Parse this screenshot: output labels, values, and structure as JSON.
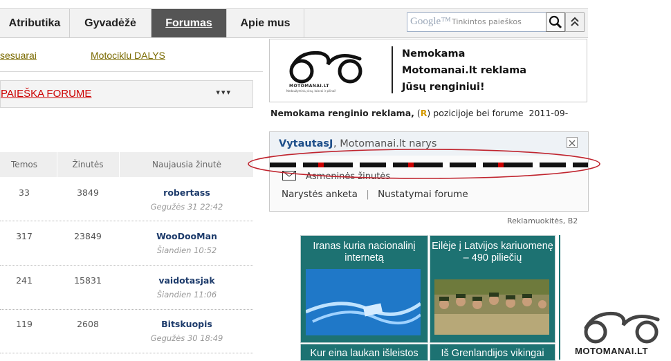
{
  "nav": {
    "items": [
      {
        "label": "Atributika"
      },
      {
        "label": "Gyvadėžė"
      },
      {
        "label": "Forumas",
        "active": true
      },
      {
        "label": "Apie mus"
      }
    ]
  },
  "search": {
    "brand": "Google™",
    "placeholder": "Tinkintos paieškos"
  },
  "sublinks": [
    "sesuarai",
    "Motociklu DALYS"
  ],
  "forum_search": {
    "label": "PAIEŠKA FORUME",
    "arrows": "▾▾▾"
  },
  "table": {
    "headers": [
      "Temos",
      "Žinutės",
      "Naujausia žinutė"
    ],
    "rows": [
      {
        "topics": "33",
        "posts": "3849",
        "author": "robertass",
        "date": "Gegužės 31 22:42"
      },
      {
        "topics": "317",
        "posts": "23849",
        "author": "WooDooMan",
        "date": "Šiandien 10:52"
      },
      {
        "topics": "241",
        "posts": "15831",
        "author": "vaidotasjak",
        "date": "Šiandien 11:06"
      },
      {
        "topics": "119",
        "posts": "2608",
        "author": "Bitskuopis",
        "date": "Gegužės 30 18:49"
      }
    ]
  },
  "ad": {
    "logo_text": "MOTOMANAI.LT",
    "logo_sub": "Nedaužyminių visų, laisvai ir pilinai!",
    "line1": "Nemokama",
    "line2": "Motomanai.lt reklama",
    "line3": "Jūsų renginiui!"
  },
  "promo": {
    "text": "Nemokama renginio reklama,",
    "r_open": "(",
    "r": "R",
    "r_close": ")",
    "rest": "pozicijoje bei forume",
    "date": "2011-09-"
  },
  "user": {
    "name": "VytautasJ",
    "role": ", Motomanai.lt narys",
    "messages": "Asmeninės žinutės",
    "link1": "Narystės anketa",
    "sep": "|",
    "link2": "Nustatymai forume"
  },
  "sponsor": "Reklamuokitės, B2",
  "news": [
    {
      "title": "Iranas kuria nacionalinį internetą"
    },
    {
      "title": "Eilėje į Latvijos kariuomenę – 490 piliečių"
    },
    {
      "title": "Kur eina laukan išleistos"
    },
    {
      "title": "Iš Grenlandijos vikingai"
    }
  ],
  "watermark": "MOTOMANAI.LT",
  "colors": {
    "tile": "#1d7272",
    "nav_active": "#555555",
    "alert_link": "#cc0000",
    "sublink": "#7a6a00"
  }
}
